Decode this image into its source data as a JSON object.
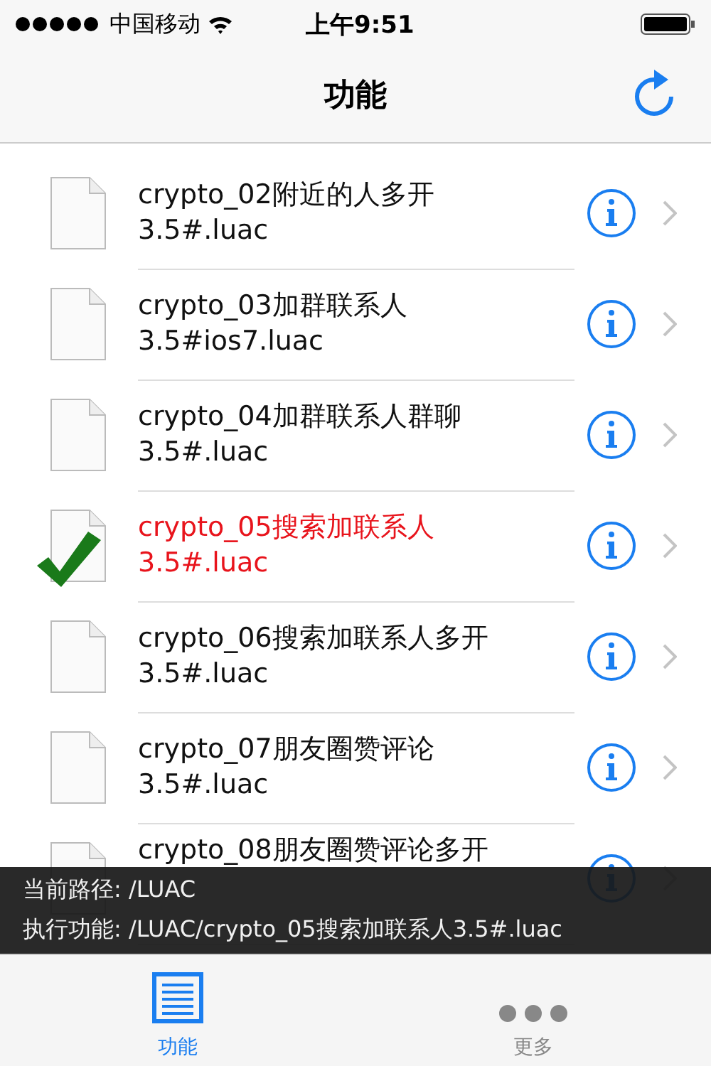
{
  "status_bar": {
    "carrier": "中国移动",
    "time": "上午9:51"
  },
  "nav": {
    "title": "功能"
  },
  "files": [
    {
      "name": "crypto_02附近的人多开",
      "ext": "3.5#.luac",
      "selected": false
    },
    {
      "name": "crypto_03加群联系人",
      "ext": "3.5#ios7.luac",
      "selected": false
    },
    {
      "name": "crypto_04加群联系人群聊",
      "ext": "3.5#.luac",
      "selected": false
    },
    {
      "name": "crypto_05搜索加联系人",
      "ext": "3.5#.luac",
      "selected": true
    },
    {
      "name": "crypto_06搜索加联系人多开",
      "ext": "3.5#.luac",
      "selected": false
    },
    {
      "name": "crypto_07朋友圈赞评论",
      "ext": "3.5#.luac",
      "selected": false
    },
    {
      "name": "crypto_08朋友圈赞评论多开",
      "selected": false
    }
  ],
  "overlay": {
    "current_path": "当前路径: /LUAC",
    "executing": "执行功能: /LUAC/crypto_05搜索加联系人3.5#.luac"
  },
  "tab_bar": [
    {
      "label": "功能",
      "selected": true,
      "kind": "list"
    },
    {
      "label": "更多",
      "selected": false,
      "kind": "more"
    }
  ]
}
